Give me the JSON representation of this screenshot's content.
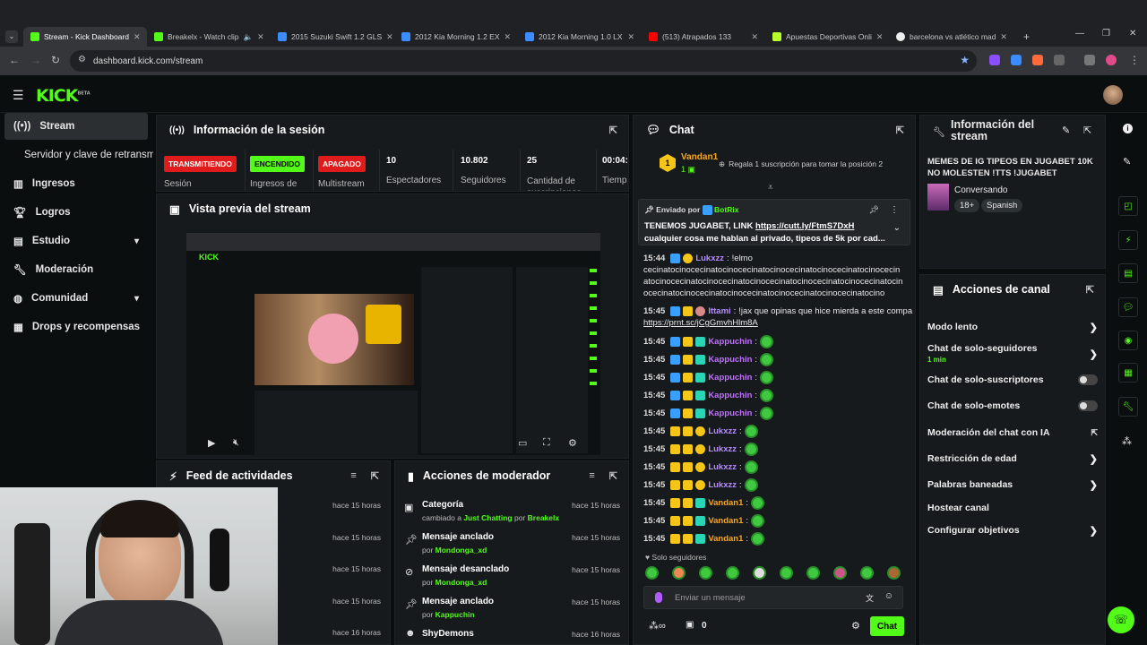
{
  "browser": {
    "tabs": [
      {
        "label": "Stream - Kick Dashboard",
        "color": "#53fc18"
      },
      {
        "label": "Breakelx - Watch clip",
        "color": "#53fc18"
      },
      {
        "label": "2015 Suzuki Swift 1.2 GLS",
        "color": "#3b8cff"
      },
      {
        "label": "2012 Kia Morning 1.2 EX",
        "color": "#3b8cff"
      },
      {
        "label": "2012 Kia Morning 1.0 LX",
        "color": "#3b8cff"
      },
      {
        "label": "(513) Atrapados 133",
        "color": "#ff0000"
      },
      {
        "label": "Apuestas Deportivas Onli",
        "color": "#b8ff2e"
      },
      {
        "label": "barcelona vs atlético mad",
        "color": "#eeeeee"
      }
    ],
    "url": "dashboard.kick.com/stream"
  },
  "logo": "KICK",
  "logo_beta": "BETA",
  "sidebar": {
    "items": [
      {
        "label": "Stream",
        "icon": "broadcast-icon"
      },
      {
        "label": "Servidor y clave de retransmisión",
        "icon": ""
      },
      {
        "label": "Ingresos",
        "icon": "chart-icon"
      },
      {
        "label": "Logros",
        "icon": "trophy-icon"
      },
      {
        "label": "Estudio",
        "icon": "studio-icon"
      },
      {
        "label": "Moderación",
        "icon": "wrench-icon"
      },
      {
        "label": "Comunidad",
        "icon": "community-icon"
      },
      {
        "label": "Drops y recompensas",
        "icon": "drops-icon"
      }
    ]
  },
  "session": {
    "title": "Información de la sesión",
    "stats": [
      {
        "badge": "TRANSMITIENDO",
        "label": "Sesión"
      },
      {
        "badge": "ENCENDIDO",
        "label": "Ingresos de"
      },
      {
        "badge": "APAGADO",
        "label": "Multistream"
      },
      {
        "value": "10",
        "label": "Espectadores"
      },
      {
        "value": "10.802",
        "label": "Seguidores"
      },
      {
        "value": "25",
        "label": "Cantidad de suscripciones"
      },
      {
        "value": "00:04:",
        "label": "Tiemp"
      }
    ]
  },
  "preview": {
    "title": "Vista previa del stream"
  },
  "feed": {
    "title": "Feed de actividades",
    "times": [
      "hace 15 horas",
      "hace 15 horas",
      "hace 15 horas",
      "hace 15 horas",
      "hace 16 horas"
    ]
  },
  "modactions": {
    "title": "Acciones de moderador",
    "rows": [
      {
        "title": "Categoría",
        "sub_pre": "cambiado a ",
        "sub_hl": "Just Chatting",
        "sub_mid": " por ",
        "sub_user": "Breakelx",
        "time": "hace 15 horas"
      },
      {
        "title": "Mensaje anclado",
        "sub_pre": "por ",
        "sub_hl": "",
        "sub_mid": "",
        "sub_user": "Mondonga_xd",
        "time": "hace 15 horas"
      },
      {
        "title": "Mensaje desanclado",
        "sub_pre": "por ",
        "sub_hl": "",
        "sub_mid": "",
        "sub_user": "Mondonga_xd",
        "time": "hace 15 horas"
      },
      {
        "title": "Mensaje anclado",
        "sub_pre": "por ",
        "sub_hl": "",
        "sub_mid": "",
        "sub_user": "Kappuchin",
        "time": "hace 15 horas"
      },
      {
        "title": "ShyDemons",
        "sub_pre": "",
        "sub_hl": "",
        "sub_mid": "",
        "sub_user": "",
        "time": "hace 16 horas"
      }
    ]
  },
  "chat": {
    "title": "Chat",
    "gift_user": "Vandan1",
    "gift_count": "1",
    "gift_text": "Regala 1 suscripción para tomar la posición 2",
    "pinned_by": "Enviado por",
    "pinned_user": "BotRix",
    "pinned_text": "TENEMOS JUGABET, LINK",
    "pinned_link": "https://cutt.ly/FtmS7DxH",
    "pinned_text2": "cualquier cosa me hablan al privado, tipeos de 5k por cad...",
    "messages": [
      {
        "ts": "15:44",
        "user": "Lukxzz",
        "color": "#b68cff",
        "text": "!elmo"
      },
      {
        "ts": "15:45",
        "user": "Ittami",
        "color": "#b68cff",
        "text": "!jax que opinas que hice mierda a este compa"
      },
      {
        "ts": "15:45",
        "user": "Kappuchin",
        "color": "#c070ff"
      },
      {
        "ts": "15:45",
        "user": "Kappuchin",
        "color": "#c070ff"
      },
      {
        "ts": "15:45",
        "user": "Kappuchin",
        "color": "#c070ff"
      },
      {
        "ts": "15:45",
        "user": "Kappuchin",
        "color": "#c070ff"
      },
      {
        "ts": "15:45",
        "user": "Kappuchin",
        "color": "#c070ff"
      },
      {
        "ts": "15:45",
        "user": "Lukxzz",
        "color": "#b68cff"
      },
      {
        "ts": "15:45",
        "user": "Lukxzz",
        "color": "#b68cff"
      },
      {
        "ts": "15:45",
        "user": "Lukxzz",
        "color": "#b68cff"
      },
      {
        "ts": "15:45",
        "user": "Lukxzz",
        "color": "#b68cff"
      },
      {
        "ts": "15:45",
        "user": "Vandan1",
        "color": "#f5a623"
      },
      {
        "ts": "15:45",
        "user": "Vandan1",
        "color": "#f5a623"
      },
      {
        "ts": "15:45",
        "user": "Vandan1",
        "color": "#f5a623"
      }
    ],
    "elmo_lines": [
      "cecinatocinocecinatocinocecinatocinocecinatocinocecinatocinocecin",
      "atocinocecinatocinocecinatocinocecinatocinocecinatocinocecinatocin",
      "ocecinatocinocecinatocinocecinatocinocecinatocinocecinatocino"
    ],
    "ittami_link": "https://prnt.sc/jCgGmvhHlm8A",
    "followers_only": "Solo seguidores",
    "input_placeholder": "Enviar un mensaje",
    "count": "0",
    "send_label": "Chat"
  },
  "stream_info": {
    "title": "Información del stream",
    "stream_title": "MEMES DE IG TIPEOS EN JUGABET 10K NO MOLESTEN !TTS !JUGABET",
    "category": "Conversando",
    "tags": [
      "18+",
      "Spanish"
    ]
  },
  "channel_actions": {
    "title": "Acciones de canal",
    "items": [
      {
        "label": "Modo lento",
        "control": "chevron"
      },
      {
        "label": "Chat de solo-seguidores",
        "sub": "1 min",
        "control": "chevron"
      },
      {
        "label": "Chat de solo-suscriptores",
        "control": "toggle"
      },
      {
        "label": "Chat de solo-emotes",
        "control": "toggle"
      },
      {
        "label": "Moderación del chat con IA",
        "control": "external"
      },
      {
        "label": "Restricción de edad",
        "control": "chevron"
      },
      {
        "label": "Palabras baneadas",
        "control": "chevron"
      },
      {
        "label": "Hostear canal",
        "control": "none"
      },
      {
        "label": "Configurar objetivos",
        "control": "chevron"
      }
    ]
  },
  "colors": {
    "accent": "#53fc18",
    "panel": "#171a1c"
  }
}
